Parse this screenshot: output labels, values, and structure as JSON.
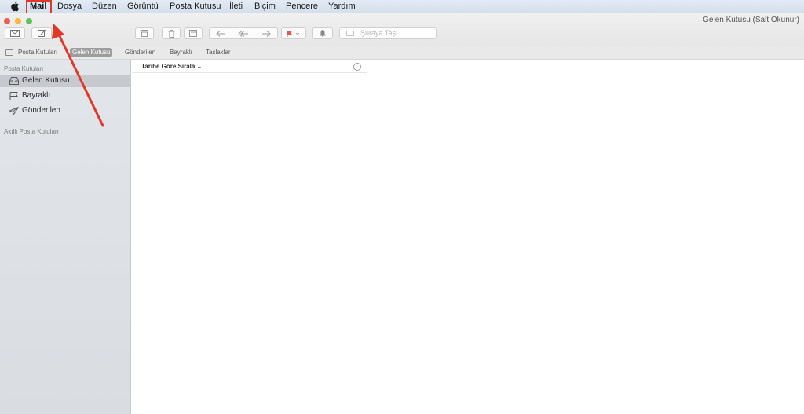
{
  "menubar": {
    "items": [
      "Mail",
      "Dosya",
      "Düzen",
      "Görüntü",
      "Posta Kutusu",
      "İleti",
      "Biçim",
      "Pencere",
      "Yardım"
    ]
  },
  "window": {
    "title": "Gelen Kutusu (Salt Okunur)"
  },
  "toolbar": {
    "move_placeholder": "Şuraya Taşı..."
  },
  "favorites": {
    "items": [
      "Posta Kutuları",
      "Gelen Kutusu",
      "Gönderilen",
      "Bayraklı",
      "Taslaklar"
    ],
    "active": "Gelen Kutusu"
  },
  "sidebar": {
    "header": "Posta Kutuları",
    "items": [
      "Gelen Kutusu",
      "Bayraklı",
      "Gönderilen"
    ],
    "smart_header": "Akıllı Posta Kutuları"
  },
  "message_list": {
    "sort_label": "Tarihe Göre Sırala ⌄"
  },
  "colors": {
    "annotation": "#e2382a",
    "selected_sidebar": "#c6c9cd",
    "active_favorite": "#9d9d9d"
  },
  "icons": [
    "apple-icon",
    "get-mail-icon",
    "compose-icon",
    "archive-icon",
    "trash-icon",
    "junk-icon",
    "reply-icon",
    "reply-all-icon",
    "forward-icon",
    "flag-icon",
    "bell-icon",
    "inbox-icon",
    "flag-outline-icon",
    "paper-plane-icon",
    "filter-icon"
  ]
}
